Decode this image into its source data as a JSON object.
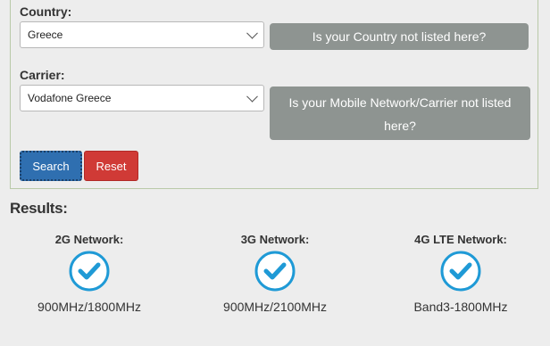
{
  "form": {
    "country_label": "Country:",
    "country_value": "Greece",
    "country_not_listed": "Is your Country not listed here?",
    "carrier_label": "Carrier:",
    "carrier_value": "Vodafone Greece",
    "carrier_not_listed_line1": "Is your Mobile Network/Carrier not listed",
    "carrier_not_listed_line2": "here?",
    "search_label": "Search",
    "reset_label": "Reset"
  },
  "results": {
    "title": "Results:",
    "networks": [
      {
        "label": "2G Network:",
        "freq": "900MHz/1800MHz",
        "supported": true
      },
      {
        "label": "3G Network:",
        "freq": "900MHz/2100MHz",
        "supported": true
      },
      {
        "label": "4G LTE Network:",
        "freq": "Band3-1800MHz",
        "supported": true
      }
    ]
  },
  "colors": {
    "check": "#1f9ad6",
    "search_btn": "#2f6fb0",
    "reset_btn": "#d03a36",
    "gray_btn": "#8e9491"
  }
}
